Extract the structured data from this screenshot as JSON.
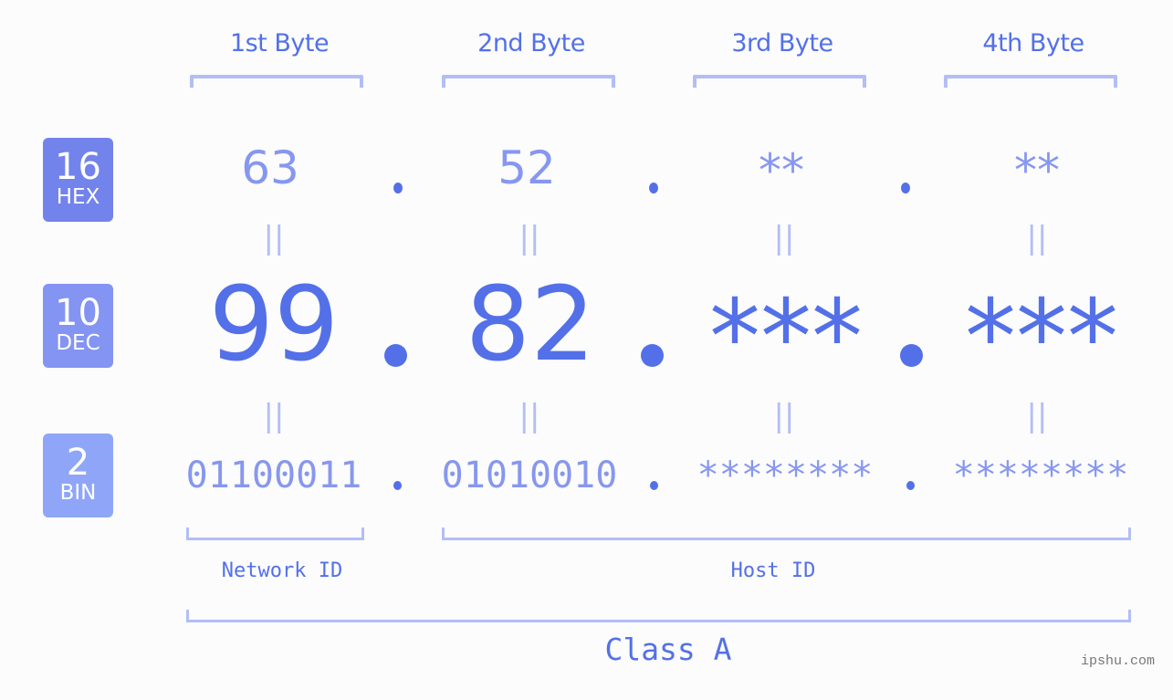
{
  "colors": {
    "accent": "#5470e8",
    "light_accent": "#8797ef",
    "bracket": "#b3bef5",
    "hex_badge": "#7383ec",
    "dec_badge": "#8494f2",
    "bin_badge": "#8fa6f8",
    "background": "#fbfcfb"
  },
  "headers": [
    "1st Byte",
    "2nd Byte",
    "3rd Byte",
    "4th Byte"
  ],
  "badges": {
    "hex": {
      "number": "16",
      "label": "HEX"
    },
    "dec": {
      "number": "10",
      "label": "DEC"
    },
    "bin": {
      "number": "2",
      "label": "BIN"
    }
  },
  "hex": [
    "63",
    "52",
    "**",
    "**"
  ],
  "dec": [
    "99",
    "82",
    "***",
    "***"
  ],
  "bin": [
    "01100011",
    "01010010",
    "********",
    "********"
  ],
  "equals_symbol": "||",
  "segments": {
    "network": "Network ID",
    "host": "Host ID"
  },
  "ip_class": "Class A",
  "watermark": "ipshu.com"
}
